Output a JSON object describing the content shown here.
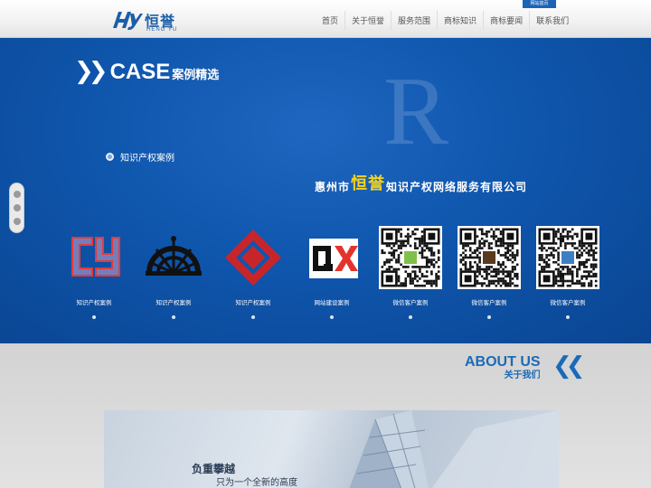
{
  "header": {
    "logo_cn": "恒誉",
    "logo_en": "HENG YU",
    "home_badge": "网站首页",
    "nav": [
      "首页",
      "关于恒誉",
      "服务范围",
      "商标知识",
      "商标要闻",
      "联系我们"
    ]
  },
  "case_section": {
    "title_en": "CASE",
    "title_cn": "案例精选",
    "watermark": "R",
    "tagline": "知识产权案例",
    "company_pre": "惠州市",
    "company_hl": "恒誉",
    "company_post": "知识产权网络服务有限公司",
    "items": [
      {
        "label": "知识产权案例",
        "icon": "cy-logo-icon"
      },
      {
        "label": "知识产权案例",
        "icon": "ship-wheel-logo-icon"
      },
      {
        "label": "知识产权案例",
        "icon": "red-diamond-logo-icon"
      },
      {
        "label": "网站建设案例",
        "icon": "qx-logo-icon"
      },
      {
        "label": "微信客户案例",
        "icon": "qr-code-icon"
      },
      {
        "label": "微信客户案例",
        "icon": "qr-code-icon"
      },
      {
        "label": "微信客户案例",
        "icon": "qr-code-icon"
      }
    ]
  },
  "about_section": {
    "title_en": "ABOUT US",
    "title_cn": "关于我们",
    "image_line1": "负重攀越",
    "image_line2": "只为一个全新的高度"
  },
  "colors": {
    "brand_blue": "#1b64b5",
    "banner_blue": "#0f56ad",
    "highlight_yellow": "#f3d21e"
  }
}
